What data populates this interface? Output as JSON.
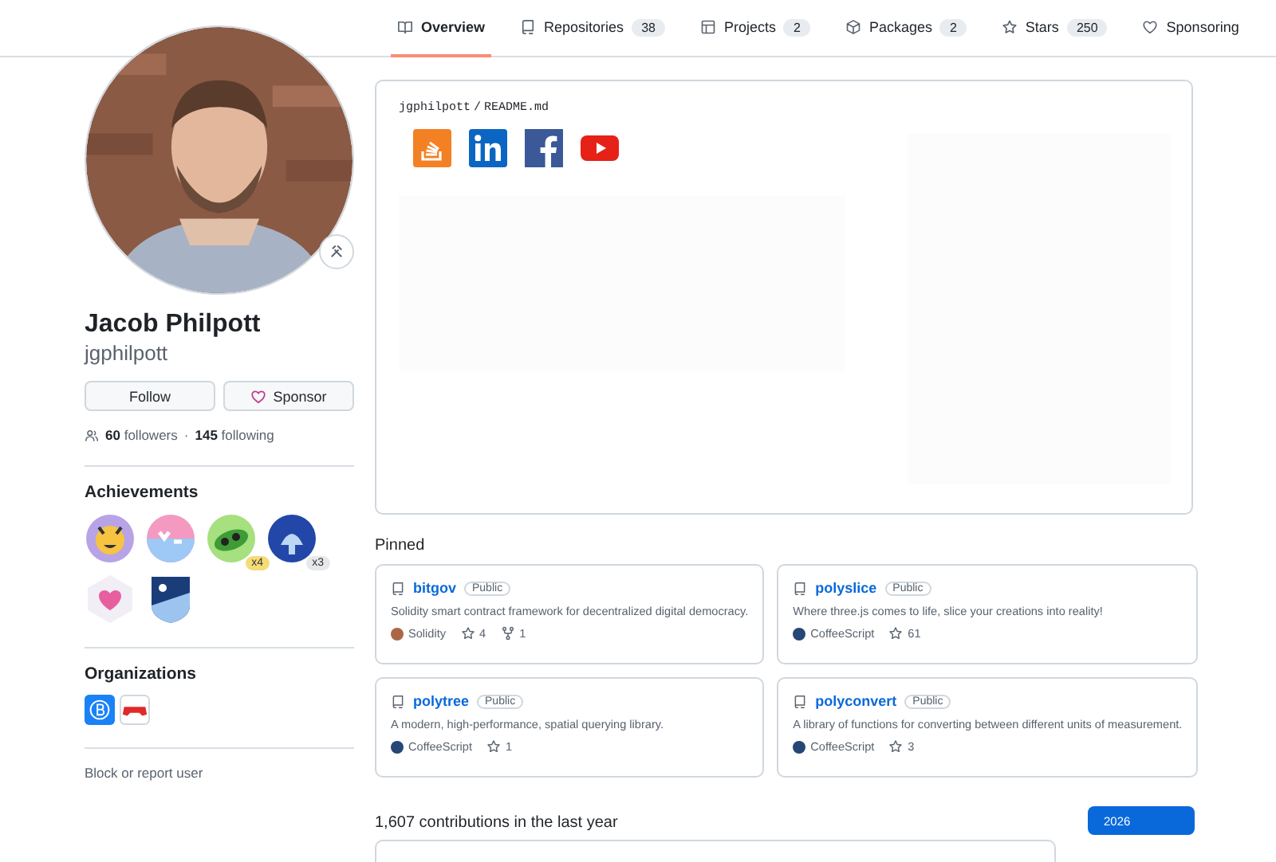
{
  "tabs": [
    {
      "label": "Overview",
      "kind": "book",
      "selected": true
    },
    {
      "label": "Repositories",
      "kind": "repo",
      "count": "38",
      "selected": false
    },
    {
      "label": "Projects",
      "kind": "table",
      "count": "2",
      "selected": false
    },
    {
      "label": "Packages",
      "kind": "package",
      "count": "2",
      "selected": false
    },
    {
      "label": "Stars",
      "kind": "star",
      "count": "250",
      "selected": false
    },
    {
      "label": "Sponsoring",
      "kind": "heart",
      "selected": false
    }
  ],
  "profile": {
    "name": "Jacob Philpott",
    "username": "jgphilpott",
    "buttons": [
      "Follow",
      "Sponsor"
    ],
    "followers_count": "60",
    "followers_label": "followers",
    "separator": "·",
    "following_count": "145",
    "following_label": "following"
  },
  "achievements": {
    "title": "Achievements",
    "badges": [
      {
        "kind": "starstruck"
      },
      {
        "kind": "yolo"
      },
      {
        "kind": "pair",
        "count": "x4"
      },
      {
        "kind": "shark",
        "count": "x3"
      },
      {
        "kind": "heart"
      },
      {
        "kind": "arctic"
      }
    ]
  },
  "organizations": {
    "title": "Organizations",
    "items": [
      {
        "kind": "circle-b"
      },
      {
        "kind": "gamepad"
      }
    ]
  },
  "block_link": "Block or report user",
  "readme": {
    "path_user": "jgphilpott",
    "path_sep": "/",
    "path_file": "README.md",
    "links": [
      {
        "kind": "stackoverflow"
      },
      {
        "kind": "linkedin"
      },
      {
        "kind": "facebook"
      },
      {
        "kind": "youtube"
      }
    ]
  },
  "pinned": {
    "title": "Pinned",
    "repos": [
      {
        "name": "bitgov",
        "visibility": "Public",
        "description": "Solidity smart contract framework for decentralized digital democracy.",
        "language": "Solidity",
        "color": "#aa6746",
        "stars": "4",
        "forks": "1"
      },
      {
        "name": "polyslice",
        "visibility": "Public",
        "description": "Where three.js comes to life, slice your creations into reality!",
        "language": "CoffeeScript",
        "color": "#244776",
        "stars": "61"
      },
      {
        "name": "polytree",
        "visibility": "Public",
        "description": "A modern, high-performance, spatial querying library.",
        "language": "CoffeeScript",
        "color": "#244776",
        "stars": "1"
      },
      {
        "name": "polyconvert",
        "visibility": "Public",
        "description": "A library of functions for converting between different units of measurement.",
        "language": "CoffeeScript",
        "color": "#244776",
        "stars": "3"
      }
    ]
  },
  "contributions": {
    "title": "1,607 contributions in the last year",
    "years": [
      {
        "label": "2026",
        "selected": true
      }
    ]
  }
}
